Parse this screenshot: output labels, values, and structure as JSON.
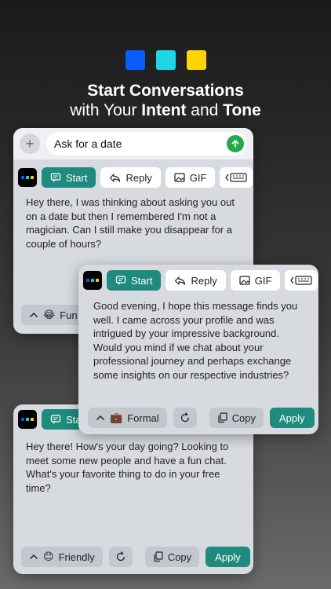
{
  "brand_colors": [
    "#0a5cff",
    "#1ed6e6",
    "#ffd500"
  ],
  "headline": {
    "line1": "Start Conversations",
    "line2_pre": "with Your ",
    "intent": "Intent",
    "and": " and ",
    "tone": "Tone"
  },
  "input": {
    "value": "Ask for a date"
  },
  "toolbar": {
    "start": "Start",
    "reply": "Reply",
    "gif": "GIF",
    "start_partial": "Sta"
  },
  "cards": {
    "back_top": {
      "message": "Hey there, I was thinking about asking you out on a date but then I remembered I'm not a magician. Can I still make you disappear for a couple of hours?",
      "tone_emoji": "😂",
      "tone_partial": "Fun"
    },
    "front": {
      "message": "Good evening, I hope this message finds you well. I came across your profile and was intrigued by your impressive background. Would you mind if we chat about your professional journey and perhaps exchange some insights on our respective industries?",
      "tone_emoji": "💼",
      "tone": "Formal",
      "copy": "Copy",
      "apply": "Apply"
    },
    "bottom": {
      "message": "Hey there! How's your day going? Looking to meet some new people and have a fun chat. What's your favorite thing to do in your free time?",
      "tone_emoji": "😊",
      "tone": "Friendly",
      "copy": "Copy",
      "apply": "Apply"
    }
  }
}
